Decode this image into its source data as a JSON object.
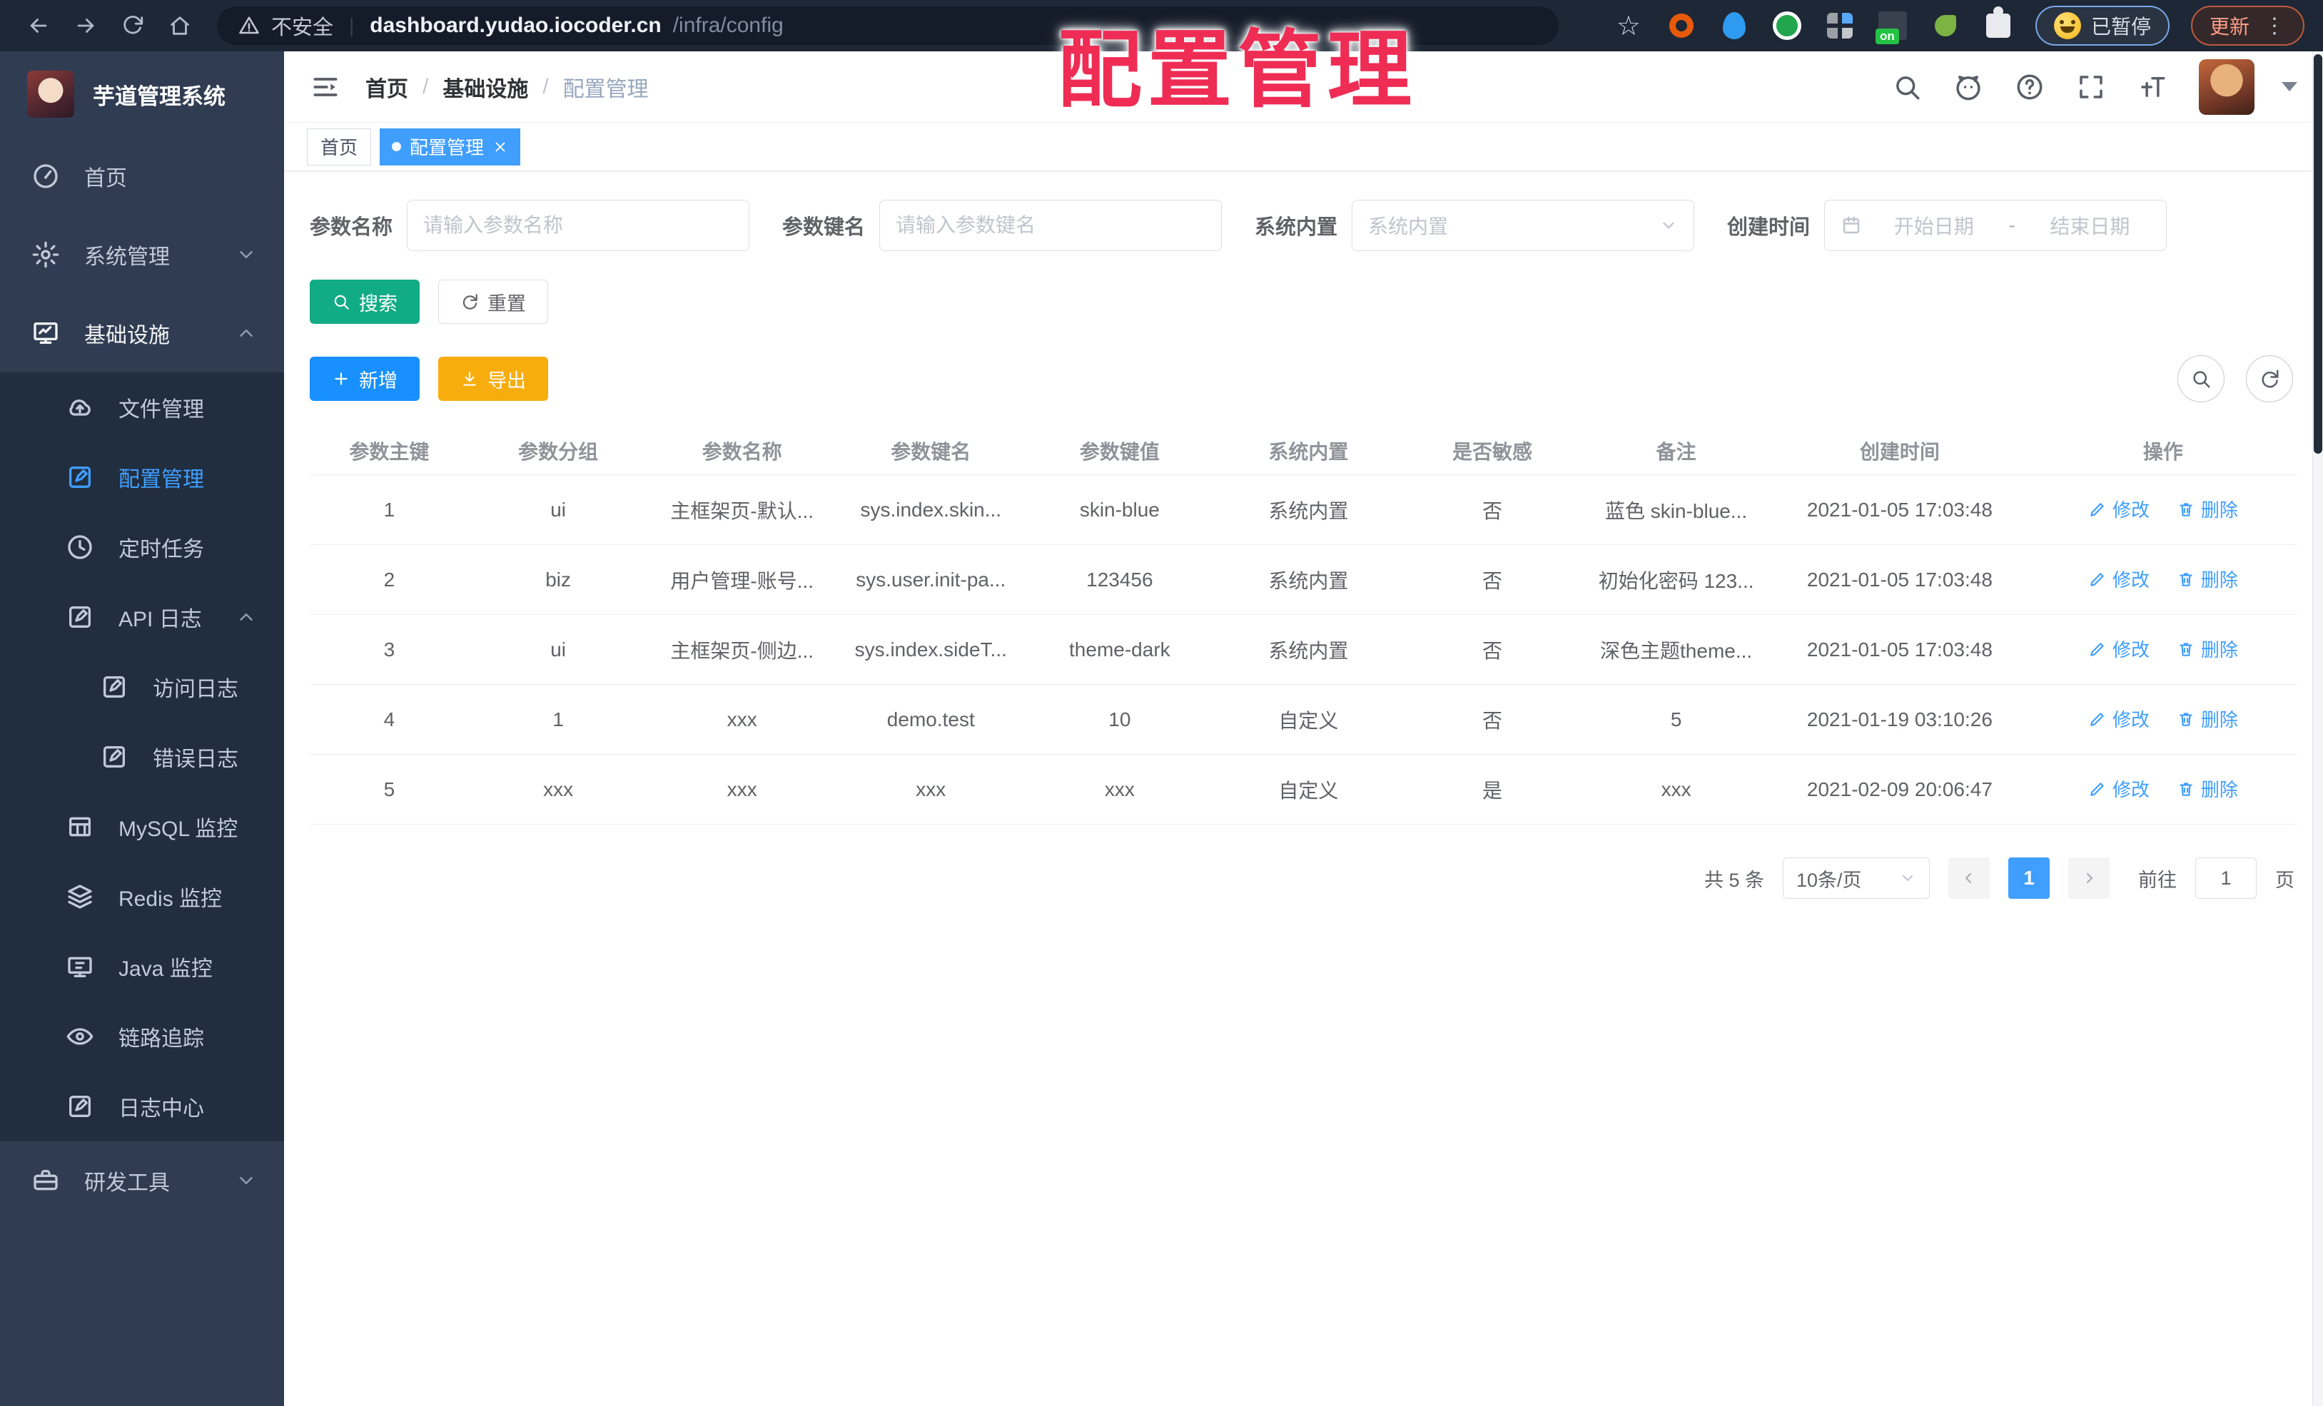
{
  "browser": {
    "security_label": "不安全",
    "url_host": "dashboard.yudao.iocoder.cn",
    "url_path": "/infra/config",
    "paused_label": "已暂停",
    "update_label": "更新",
    "menu_dots": "⋮"
  },
  "overlay_title": "配置管理",
  "sidebar": {
    "title": "芋道管理系统",
    "home": "首页",
    "system": "系统管理",
    "infra": "基础设施",
    "file": "文件管理",
    "config": "配置管理",
    "job": "定时任务",
    "api_log": "API 日志",
    "access_log": "访问日志",
    "error_log": "错误日志",
    "mysql": "MySQL 监控",
    "redis": "Redis 监控",
    "java": "Java 监控",
    "trace": "链路追踪",
    "log_center": "日志中心",
    "dev_tools": "研发工具"
  },
  "header": {
    "breadcrumb": [
      "首页",
      "基础设施",
      "配置管理"
    ]
  },
  "tabs": {
    "home": "首页",
    "active": "配置管理"
  },
  "filters": {
    "param_name": {
      "label": "参数名称",
      "placeholder": "请输入参数名称"
    },
    "param_key": {
      "label": "参数键名",
      "placeholder": "请输入参数键名"
    },
    "builtin": {
      "label": "系统内置",
      "placeholder": "系统内置"
    },
    "create_time": {
      "label": "创建时间",
      "start": "开始日期",
      "separator": "-",
      "end": "结束日期"
    }
  },
  "actions": {
    "search": "搜索",
    "reset": "重置",
    "add": "新增",
    "export": "导出"
  },
  "table": {
    "columns": [
      "参数主键",
      "参数分组",
      "参数名称",
      "参数键名",
      "参数键值",
      "系统内置",
      "是否敏感",
      "备注",
      "创建时间",
      "操作"
    ],
    "rows": [
      [
        "1",
        "ui",
        "主框架页-默认...",
        "sys.index.skin...",
        "skin-blue",
        "系统内置",
        "否",
        "蓝色 skin-blue...",
        "2021-01-05 17:03:48"
      ],
      [
        "2",
        "biz",
        "用户管理-账号...",
        "sys.user.init-pa...",
        "123456",
        "系统内置",
        "否",
        "初始化密码 123...",
        "2021-01-05 17:03:48"
      ],
      [
        "3",
        "ui",
        "主框架页-侧边...",
        "sys.index.sideT...",
        "theme-dark",
        "系统内置",
        "否",
        "深色主题theme...",
        "2021-01-05 17:03:48"
      ],
      [
        "4",
        "1",
        "xxx",
        "demo.test",
        "10",
        "自定义",
        "否",
        "5",
        "2021-01-19 03:10:26"
      ],
      [
        "5",
        "xxx",
        "xxx",
        "xxx",
        "xxx",
        "自定义",
        "是",
        "xxx",
        "2021-02-09 20:06:47"
      ]
    ],
    "edit_label": "修改",
    "delete_label": "删除"
  },
  "pagination": {
    "total": "共 5 条",
    "size": "10条/页",
    "page": "1",
    "goto": "前往",
    "goto_value": "1",
    "unit": "页"
  },
  "colors": {
    "primary": "#409eff",
    "search_button": "#11ab85",
    "add_button": "#1890ff",
    "export_button": "#f7ad0e",
    "sidebar_bg": "#2f3c52",
    "submenu_bg": "#202e40",
    "browser_bar_bg": "#1e2736",
    "overlay_red": "#ee2c54"
  }
}
